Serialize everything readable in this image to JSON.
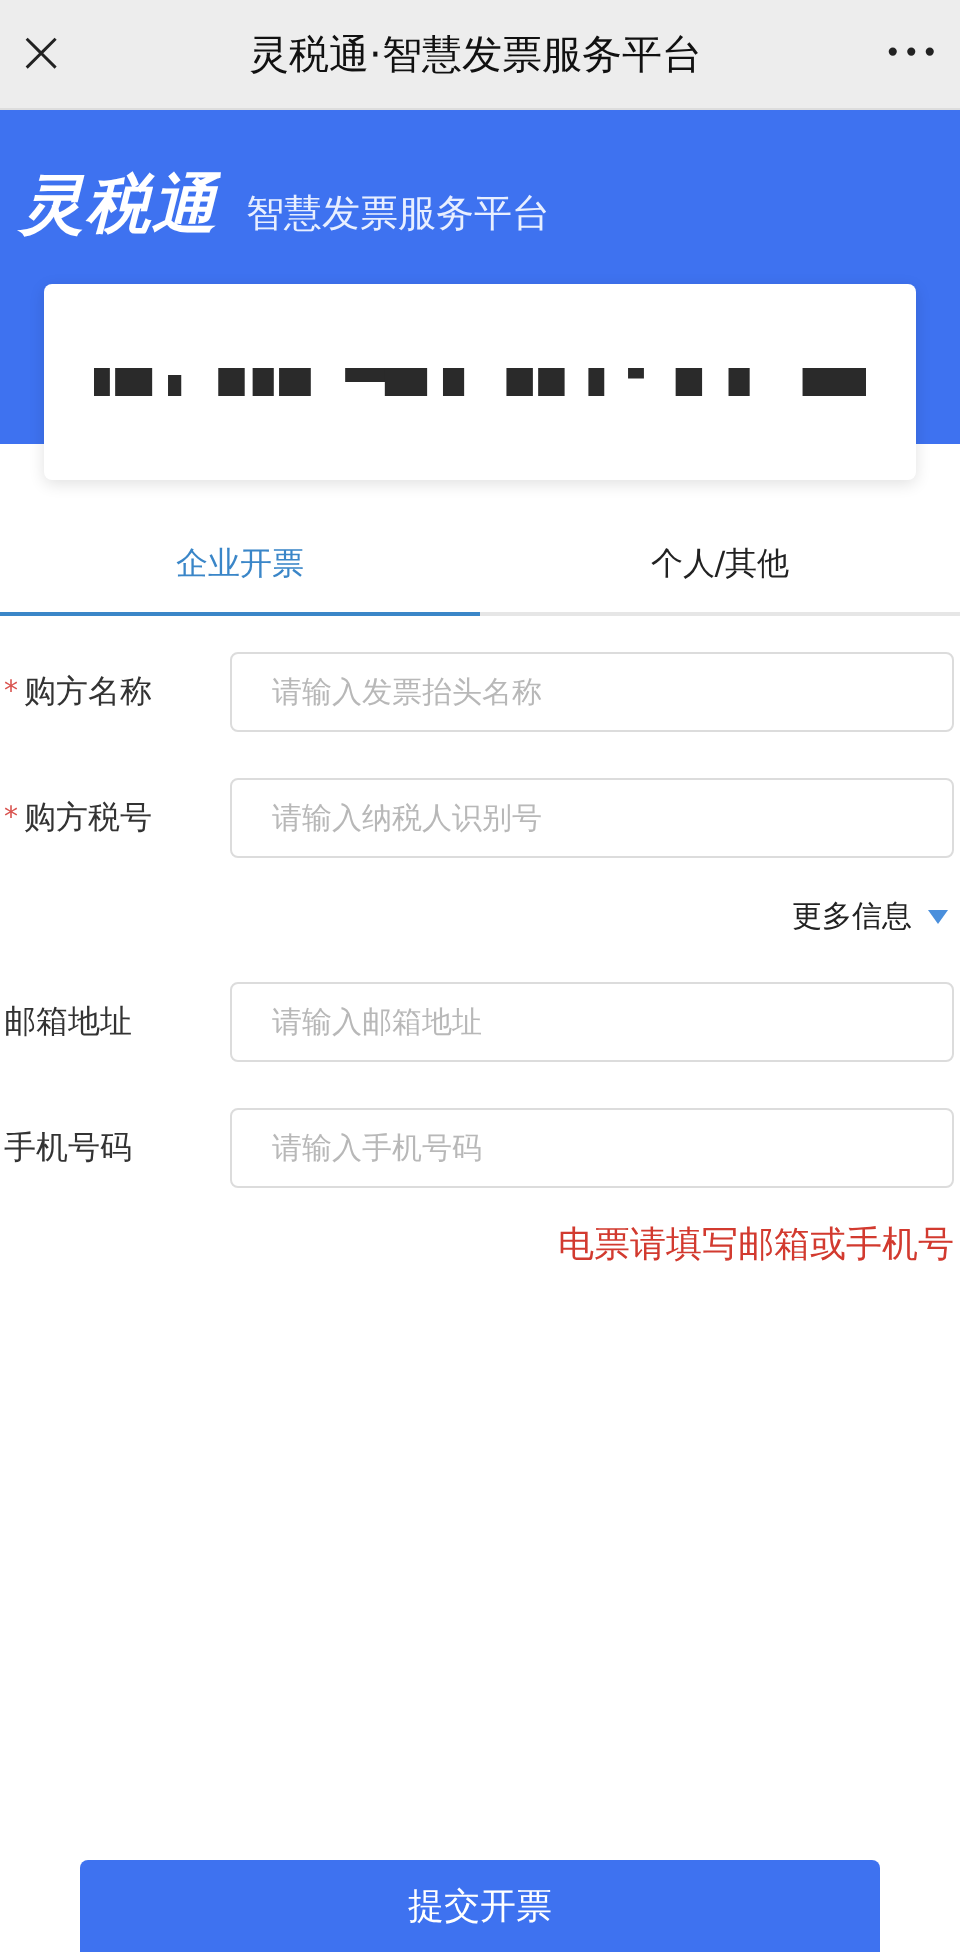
{
  "window": {
    "close": "×",
    "title": "灵税通·智慧发票服务平台",
    "more": "•••"
  },
  "header": {
    "logo": "灵税通",
    "subtitle": "智慧发票服务平台"
  },
  "tabs": [
    {
      "label": "企业开票",
      "selected": true
    },
    {
      "label": "个人/其他",
      "selected": false
    }
  ],
  "fields": [
    {
      "label": "购方名称",
      "required": true,
      "mark": "*",
      "placeholder": "请输入发票抬头名称"
    },
    {
      "label": "购方税号",
      "required": true,
      "mark": "*",
      "placeholder": "请输入纳税人识别号"
    }
  ],
  "more_info": {
    "label": "更多信息",
    "expanded": false
  },
  "contact_fields": [
    {
      "label": "邮箱地址",
      "placeholder": "请输入邮箱地址"
    },
    {
      "label": "手机号码",
      "placeholder": "请输入手机号码"
    }
  ],
  "notice": "电票请填写邮箱或手机号",
  "submit": "提交开票"
}
